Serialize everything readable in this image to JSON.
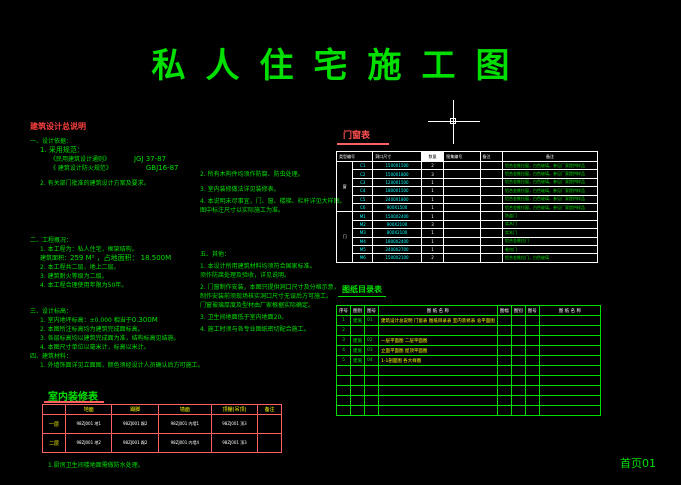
{
  "title": "私人住宅施工图",
  "page_label": "首页01",
  "design_notes": {
    "heading": "建筑设计总说明",
    "s1_title": "一、设计依据：",
    "s1_item1": "1.  采用规范：",
    "s1_std1_name": "《民用建筑设计通则》",
    "s1_std1_code": "JGJ 37-87",
    "s1_std2_name": "《  建筑设计防火规范》",
    "s1_std2_code": "GBJ16-87",
    "s1_item2": "2. 有关部门批准的建筑设计方案及要求。",
    "s2_title": "二、工程概况：",
    "s2_item1": "1.  本工程为：私人住宅，框架结构。",
    "s2_area_label": "建筑面积：",
    "s2_area_value": "259 M² ，占地面积：",
    "s2_height": "18.500M",
    "s2_item2": "2.  本工程共二层，地上二层。",
    "s2_item3": "3.  建筑耐火等级为二级。",
    "s2_item4": "4.  本工程合理使用年限为50年。",
    "s3_title": "三、设计标高：",
    "s3_item1": "1.  室内地坪标高：±0.000 相当于",
    "s3_value": "0.300M",
    "s3_item2": "2.  本图所注标高均为建筑完成面标高。",
    "s3_item3": "3.  各层标高均以建筑完成面为准，结构标高见结施。",
    "s3_item4": "4.  本图尺寸单位以毫米计，标高以米计。",
    "s4_title": "四、建筑材料：",
    "s4_item1": "1.  外墙饰面详见立面图，颜色须经设计人员确认后方可施工。",
    "mid_item2": "2.  所有木构件均须作防腐、防虫处理。",
    "mid_item3": "3.  室内装修做法详见装修表。",
    "mid_item4": "4.  本说明未尽事宜，门、窗、楼梯、栏杆详见大样图。",
    "mid_item4b": "   图中标注尺寸以实际施工为准。",
    "mid2_title": "五、其他：",
    "mid2_item1": "1.  本设计所用建筑材料均须符合国家标准。",
    "mid2_item1b": "   须作防腐处理及验收，详见说明。",
    "mid2_item2": "2.  门窗制作安装，本图只提供洞口尺寸及分格示意，",
    "mid2_item2b": "   制作安装前须现场核实洞口尺寸无误后方可施工。",
    "mid2_item2c": "   门窗玻璃厚度及型材由厂家根据实际确定。",
    "mid2_item3": "3.  卫生间地面低于室内地面20。",
    "mid2_item4": "4.  施工时须与各专业图纸密切配合施工。"
  },
  "door_window": {
    "heading": "门窗表",
    "headers": [
      "类型编号",
      "洞口尺寸",
      "数量",
      "图集编号",
      "备注",
      "备注"
    ],
    "group_window": "窗",
    "group_door": "门",
    "rows": [
      {
        "code": "C1",
        "size": "1500X1500",
        "qty": "2",
        "note": "铝合金推拉窗，白色玻璃，参见厂家提供样品"
      },
      {
        "code": "C2",
        "size": "1500X1800",
        "qty": "3",
        "note": "铝合金推拉窗，白色玻璃，参见厂家提供样品"
      },
      {
        "code": "C3",
        "size": "1200X1500",
        "qty": "1",
        "note": "铝合金推拉窗，白色玻璃，参见厂家提供样品"
      },
      {
        "code": "C4",
        "size": "1800X1500",
        "qty": "1",
        "note": "铝合金推拉窗，白色玻璃，参见厂家提供样品"
      },
      {
        "code": "C5",
        "size": "2400X1800",
        "qty": "1",
        "note": "铝合金推拉窗，白色玻璃，参见厂家提供样品"
      },
      {
        "code": "C6",
        "size": "900X1500",
        "qty": "1",
        "note": "铝合金推拉窗，白色玻璃，参见厂家提供样品"
      },
      {
        "code": "M1",
        "size": "1500X2400",
        "qty": "1",
        "note": "防盗门"
      },
      {
        "code": "M2",
        "size": "900X2100",
        "qty": "3",
        "note": "实木门"
      },
      {
        "code": "M3",
        "size": "800X2100",
        "qty": "1",
        "note": "实木门"
      },
      {
        "code": "M4",
        "size": "1800X2400",
        "qty": "1",
        "note": "铝合金推拉门"
      },
      {
        "code": "M5",
        "size": "2400X2700",
        "qty": "1",
        "note": "卷帘门"
      },
      {
        "code": "M6",
        "size": "1500X2100",
        "qty": "2",
        "note": "铝合金推拉门，白色玻璃"
      }
    ]
  },
  "drawing_index": {
    "heading": "图纸目录表",
    "headers": [
      "序号",
      "图别",
      "图号",
      "图 纸 名 称",
      "图幅",
      "图别",
      "图号",
      "图 纸 名 称"
    ],
    "rows": [
      {
        "no": "1",
        "type": "建施",
        "num": "01",
        "name": "建筑设计总说明 门窗表 图纸目录表 室内装修表 总平面图"
      },
      {
        "no": "2",
        "type": "",
        "num": "",
        "name": ""
      },
      {
        "no": "3",
        "type": "建施",
        "num": "02",
        "name": "一层平面图     二层平面图"
      },
      {
        "no": "4",
        "type": "建施",
        "num": "03",
        "name": "立面平面图     屋顶平面图"
      },
      {
        "no": "5",
        "type": "建施",
        "num": "04",
        "name": "1-1剖面图     各大样图"
      },
      {
        "no": "",
        "type": "",
        "num": "",
        "name": ""
      },
      {
        "no": "",
        "type": "",
        "num": "",
        "name": ""
      },
      {
        "no": "",
        "type": "",
        "num": "",
        "name": ""
      },
      {
        "no": "",
        "type": "",
        "num": "",
        "name": ""
      },
      {
        "no": "",
        "type": "",
        "num": "",
        "name": ""
      }
    ]
  },
  "decoration": {
    "heading": "室内装修表",
    "headers": [
      "",
      "地面",
      "踢脚",
      "墙面",
      "顶棚(吊顶)",
      "备注"
    ],
    "floor1": "一层",
    "floor2": "二层",
    "r1": [
      "98ZJ001 地1",
      "98ZJ001 踢2",
      "98ZJ001 内墙1",
      "98ZJ001 顶3",
      ""
    ],
    "r2": [
      "98ZJ001 地2",
      "98ZJ001 踢2",
      "98ZJ001 内墙4",
      "98ZJ001 顶3",
      ""
    ],
    "footnote": "1.厨房卫生间楼地面需做防水处理。"
  }
}
